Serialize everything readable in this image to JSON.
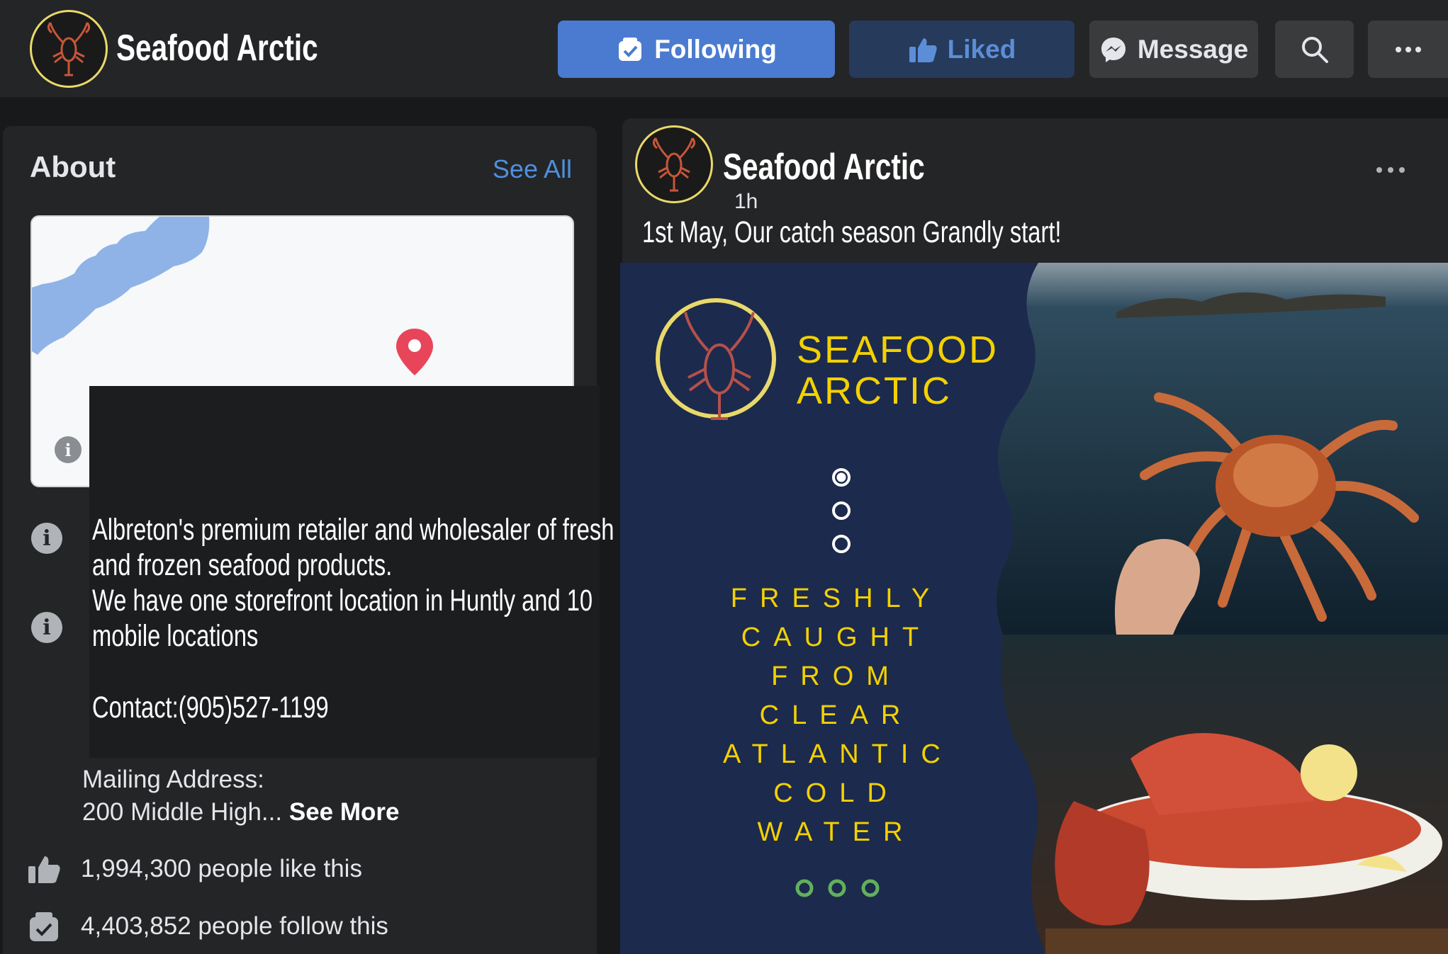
{
  "header": {
    "brand": "Seafood Arctic",
    "buttons": {
      "following": "Following",
      "liked": "Liked",
      "message": "Message"
    }
  },
  "about": {
    "title": "About",
    "see_all": "See All",
    "description_lines": [
      "Albreton's premium retailer and wholesaler of fresh",
      "and frozen seafood products.",
      "We have one storefront location in Huntly and 10",
      "mobile locations"
    ],
    "contact": "Contact:(905)527-1199",
    "mailing_label": "Mailing Address:",
    "mailing_value": "200 Middle High...",
    "see_more": "See More",
    "likes": "1,994,300 people like this",
    "follows": "4,403,852 people follow this"
  },
  "post": {
    "author": "Seafood Arctic",
    "time": "1h",
    "text": "1st May, Our catch season Grandly start!",
    "poster": {
      "title_line1": "SEAFOOD",
      "title_line2": "ARCTIC",
      "words": [
        "FRESHLY",
        "CAUGHT",
        "FROM",
        "CLEAR",
        "ATLANTIC",
        "COLD",
        "WATER"
      ]
    }
  },
  "colors": {
    "background": "#18191a",
    "card": "#242526",
    "following_button": "#4a7bd0",
    "liked_button": "#263a5c",
    "link_blue": "#4f8fe0",
    "poster_navy": "#1c2a4d",
    "poster_yellow": "#f3d100",
    "map_pin": "#e8455a"
  },
  "icons": {
    "following": "check-badge-icon",
    "liked": "thumbs-up-icon",
    "message": "messenger-icon",
    "search": "search-icon",
    "more": "more-dots-icon",
    "info": "info-icon",
    "map_pin": "map-pin-icon"
  }
}
